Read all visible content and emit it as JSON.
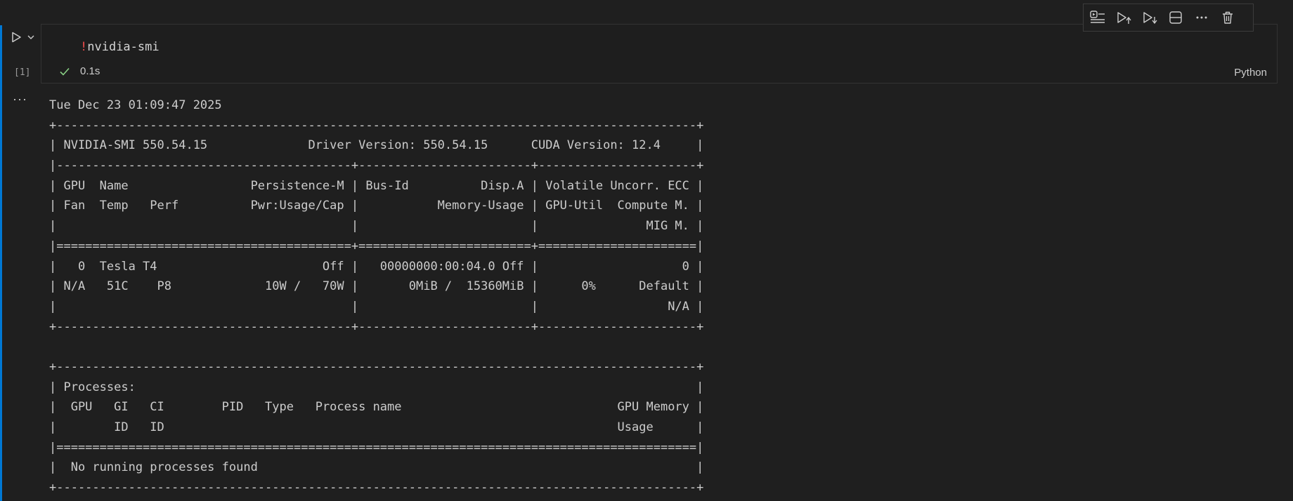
{
  "cell": {
    "execution_count": "[1]",
    "code_prefix": "!",
    "code_command": "nvidia-smi",
    "status_time": "0.1s",
    "language": "Python"
  },
  "toolbar": {
    "buttons": [
      {
        "name": "run-by-line",
        "icon": "run-by-line-icon"
      },
      {
        "name": "execute-above",
        "icon": "execute-above-icon"
      },
      {
        "name": "execute-below",
        "icon": "execute-below-icon"
      },
      {
        "name": "split-cell",
        "icon": "split-cell-icon"
      },
      {
        "name": "more-actions",
        "icon": "ellipsis-icon"
      },
      {
        "name": "delete-cell",
        "icon": "trash-icon"
      }
    ]
  },
  "output": {
    "more_label": "···",
    "lines": [
      "Tue Dec 23 01:09:47 2025       ",
      "+-----------------------------------------------------------------------------------------+",
      "| NVIDIA-SMI 550.54.15              Driver Version: 550.54.15      CUDA Version: 12.4     |",
      "|-----------------------------------------+------------------------+----------------------+",
      "| GPU  Name                 Persistence-M | Bus-Id          Disp.A | Volatile Uncorr. ECC |",
      "| Fan  Temp   Perf          Pwr:Usage/Cap |           Memory-Usage | GPU-Util  Compute M. |",
      "|                                         |                        |               MIG M. |",
      "|=========================================+========================+======================|",
      "|   0  Tesla T4                       Off |   00000000:00:04.0 Off |                    0 |",
      "| N/A   51C    P8             10W /   70W |       0MiB /  15360MiB |      0%      Default |",
      "|                                         |                        |                  N/A |",
      "+-----------------------------------------+------------------------+----------------------+",
      "                                                                                         ",
      "+-----------------------------------------------------------------------------------------+",
      "| Processes:                                                                              |",
      "|  GPU   GI   CI        PID   Type   Process name                              GPU Memory |",
      "|        ID   ID                                                               Usage      |",
      "|=========================================================================================|",
      "|  No running processes found                                                             |",
      "+-----------------------------------------------------------------------------------------+"
    ]
  },
  "colors": {
    "background": "#1f1f1f",
    "accent": "#0078d4",
    "success": "#89d185",
    "bang": "#f14c4c"
  }
}
